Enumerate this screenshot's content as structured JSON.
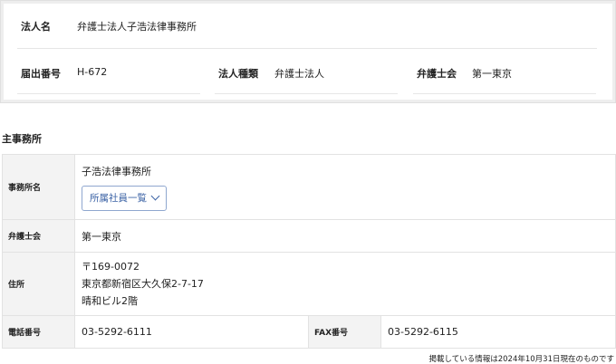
{
  "summary": {
    "corp_name_label": "法人名",
    "corp_name_value": "弁護士法人子浩法律事務所",
    "reg_no_label": "届出番号",
    "reg_no_value": "H-672",
    "corp_type_label": "法人種類",
    "corp_type_value": "弁護士法人",
    "bar_label": "弁護士会",
    "bar_value": "第一東京"
  },
  "main_office": {
    "title": "主事務所",
    "office_name_label": "事務所名",
    "office_name_value": "子浩法律事務所",
    "staff_button_label": "所属社員一覧",
    "bar_label": "弁護士会",
    "bar_value": "第一東京",
    "address_label": "住所",
    "address_postal": "〒169-0072",
    "address_line1": "東京都新宿区大久保2-7-17",
    "address_line2": "晴和ビル2階",
    "phone_label": "電話番号",
    "phone_value": "03-5292-6111",
    "fax_label": "FAX番号",
    "fax_value": "03-5292-6115"
  },
  "footer_note": "掲載している情報は2024年10月31日現在のものです"
}
